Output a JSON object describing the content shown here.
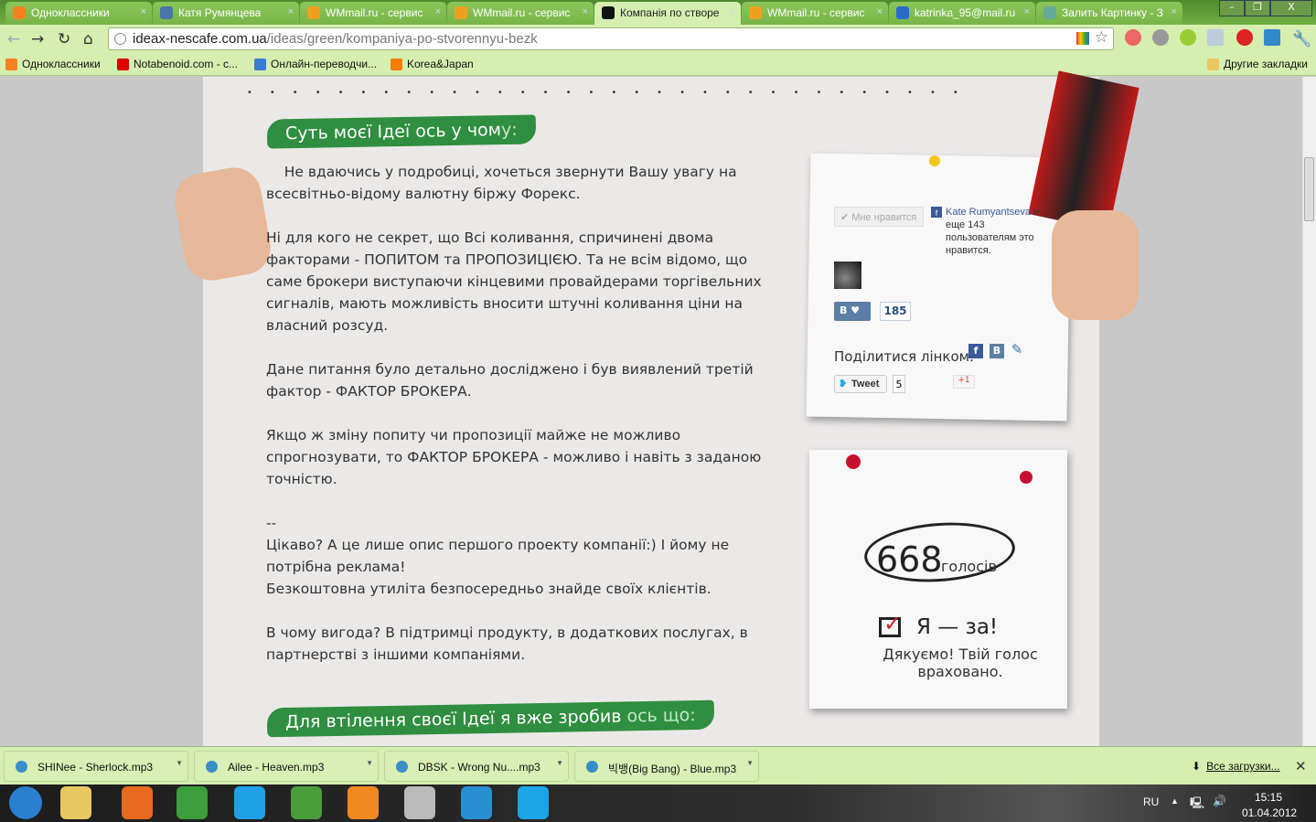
{
  "browser": {
    "tabs": [
      {
        "title": "Одноклассники",
        "icon": "odnoklassniki-icon",
        "color": "#f58220"
      },
      {
        "title": "Катя Румянцева",
        "icon": "vk-icon",
        "color": "#4a76a8"
      },
      {
        "title": "WMmail.ru - сервис",
        "icon": "wmmail-icon",
        "color": "#f0a020"
      },
      {
        "title": "WMmail.ru - сервис",
        "icon": "wmmail-icon",
        "color": "#f0a020"
      },
      {
        "title": "Компанія по створе",
        "icon": "ideax-icon",
        "color": "#111111",
        "active": true
      },
      {
        "title": "WMmail.ru - сервис",
        "icon": "wmmail-icon",
        "color": "#f0a020"
      },
      {
        "title": "katrinka_95@mail.ru",
        "icon": "mailru-icon",
        "color": "#2a6cc8"
      },
      {
        "title": "Залить Картинку - З",
        "icon": "image-icon",
        "color": "#6a9"
      }
    ],
    "url_host": "ideax-nescafe.com.ua",
    "url_path": "/ideas/green/kompaniya-po-stvorennyu-bezk",
    "bookmarks": [
      {
        "label": "Одноклассники",
        "icon": "odnoklassniki-icon",
        "color": "#f58220"
      },
      {
        "label": "Notabenoid.com - с...",
        "icon": "checkmark-icon",
        "color": "#d00"
      },
      {
        "label": "Онлайн-переводчи...",
        "icon": "globe-icon",
        "color": "#3a7bd5"
      },
      {
        "label": "Korea&Japan",
        "icon": "blogger-icon",
        "color": "#f57d00"
      }
    ],
    "other_bookmarks": "Другие закладки"
  },
  "page": {
    "heading1_main": "Суть моєї Ідеї ось у чом",
    "heading1_tail": "у:",
    "paragraphs": [
      "    Не вдаючись у подробиці, хочеться звернути Вашу увагу на всесвітньо-відому валютну біржу Форекс.",
      "Ні для кого не секрет, що Всі коливання, спричинені двома факторами - ПОПИТОМ та ПРОПОЗИЦІЄЮ. Та не всім відомо, що саме брокери виступаючи кінцевими провайдерами торгівельних сигналів, мають можливість вносити штучні коливання ціни на власний розсуд.",
      "Дане питання було детально досліджено і був виявлений третій фактор - ФАКТОР БРОКЕРА.",
      "Якщо ж зміну попиту чи пропозиції майже не можливо спрогнозувати, то ФАКТОР БРОКЕРА - можливо і навіть з заданою точністю.",
      "--\nЦікаво? А це лише опис першого проекту компанії:) І йому не потрібна реклама!\nБезкоштовна утиліта безпосередньо знайде своїх клієнтів.",
      "В чому вигода? В підтримці продукту, в додаткових послугах, в партнерстві з іншими компаніями."
    ],
    "heading2_main": "Для втілення своєї Ідеї я вже зробив ",
    "heading2_tail": "ось що:",
    "social": {
      "fb_like": "✔ Мне нравится",
      "fb_name": "Kate Rumyantseva",
      "fb_rest": " и еще 143 пользователям это нравится.",
      "vk_label": "В",
      "vk_count": "185",
      "share_label": "Поділитися лінком:",
      "tweet": "Tweet",
      "tweet_count": "5",
      "gplus": "+1"
    },
    "vote": {
      "count": "668",
      "label": "голосів",
      "button": "Я — за!",
      "thanks": "Дякуємо! Твій голос враховано."
    }
  },
  "downloads": {
    "items": [
      "SHINee - Sherlock.mp3",
      "Ailee - Heaven.mp3",
      "DBSK - Wrong Nu....mp3",
      "빅뱅(Big Bang) - Blue.mp3"
    ],
    "all": "Все загрузки..."
  },
  "taskbar": {
    "apps": [
      {
        "icon": "windows-start-icon",
        "color": "#2a7fd0"
      },
      {
        "icon": "file-explorer-icon",
        "color": "#e8c860"
      },
      {
        "icon": "firefox-icon",
        "color": "#e86a20"
      },
      {
        "icon": "chrome-icon",
        "color": "#3b9d3b"
      },
      {
        "icon": "d-app-icon",
        "color": "#1ea0e6"
      },
      {
        "icon": "utorrent-icon",
        "color": "#4a9d3a"
      },
      {
        "icon": "mail-agent-icon",
        "color": "#f08a20"
      },
      {
        "icon": "clock-app-icon",
        "color": "#bbbbbb"
      },
      {
        "icon": "dbs-icon",
        "color": "#2a8fd0"
      },
      {
        "icon": "skype-icon",
        "color": "#1ba5e6"
      }
    ],
    "lang": "RU",
    "time": "15:15",
    "date": "01.04.2012"
  }
}
